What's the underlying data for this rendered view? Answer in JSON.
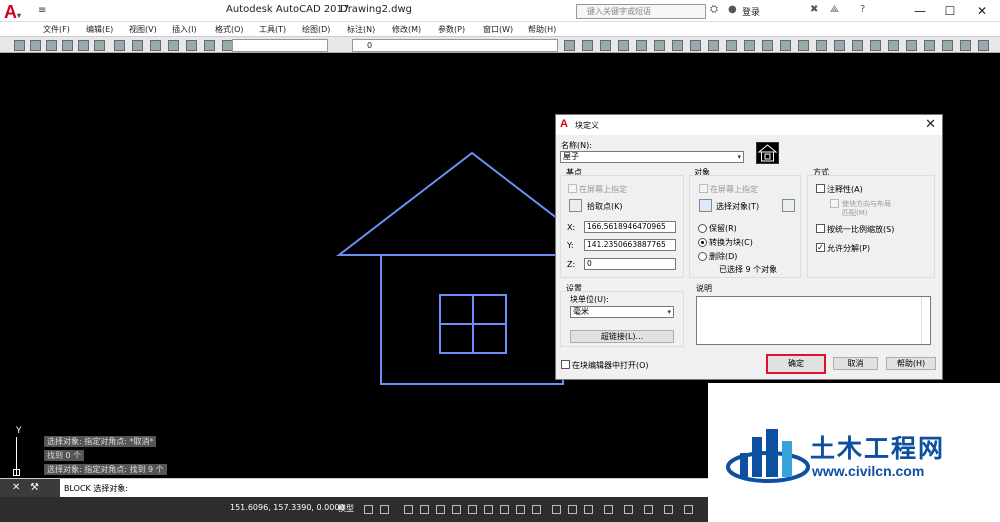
{
  "window": {
    "app_title": "Autodesk AutoCAD 2017",
    "doc_title": "Drawing2.dwg",
    "search_placeholder": "键入关键字或短语",
    "login": "登录",
    "min": "—",
    "max": "☐",
    "close": "✕"
  },
  "menu": [
    "文件(F)",
    "编辑(E)",
    "视图(V)",
    "插入(I)",
    "格式(O)",
    "工具(T)",
    "绘图(D)",
    "标注(N)",
    "修改(M)",
    "参数(P)",
    "窗口(W)",
    "帮助(H)"
  ],
  "toolbar": {
    "layer_value": "0"
  },
  "command_history": [
    "选择对象: 指定对角点: *取消*",
    "找到 0 个",
    "选择对象: 指定对角点: 找到 9 个"
  ],
  "command_line": "BLOCK 选择对象:",
  "status": {
    "coords": "151.6096, 157.3390, 0.0000",
    "model": "模型"
  },
  "dialog": {
    "title": "块定义",
    "name_label": "名称(N):",
    "name_value": "屋子",
    "basepoint": {
      "title": "基点",
      "on_screen": "在屏幕上指定",
      "pick_button": "拾取点(K)",
      "x_label": "X:",
      "x_value": "166.5618946470965",
      "y_label": "Y:",
      "y_value": "141.2350663887765",
      "z_label": "Z:",
      "z_value": "0"
    },
    "objects": {
      "title": "对象",
      "on_screen": "在屏幕上指定",
      "select_button": "选择对象(T)",
      "retain": "保留(R)",
      "convert": "转换为块(C)",
      "delete": "删除(D)",
      "selected_count": "已选择 9 个对象"
    },
    "behavior": {
      "title": "方式",
      "annotative": "注释性(A)",
      "match_orientation": "使块方向与布局",
      "match_orientation_2": "匹配(M)",
      "scale_uniformly": "按统一比例缩放(S)",
      "allow_explode": "允许分解(P)"
    },
    "settings": {
      "title": "设置",
      "unit_label": "块单位(U):",
      "unit_value": "毫米",
      "hyperlink_button": "超链接(L)..."
    },
    "description": {
      "title": "说明"
    },
    "open_in_editor": "在块编辑器中打开(O)",
    "ok": "确定",
    "cancel": "取消",
    "help": "帮助(H)"
  },
  "watermark": {
    "title": "土木工程网",
    "url": "www.civilcn.com"
  }
}
